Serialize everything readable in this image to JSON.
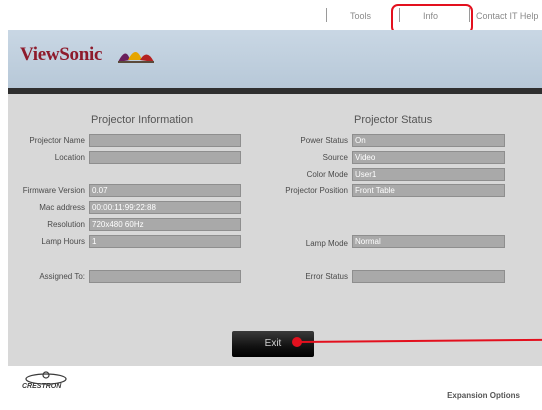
{
  "nav": {
    "tools": "Tools",
    "info": "Info",
    "contact": "Contact IT Help"
  },
  "brand": {
    "name": "ViewSonic",
    "logo_icon": "viewsonic-birds-icon"
  },
  "projector_information": {
    "title": "Projector Information",
    "fields": {
      "projector_name": {
        "label": "Projector Name",
        "value": ""
      },
      "location": {
        "label": "Location",
        "value": ""
      },
      "firmware_version": {
        "label": "Firmware Version",
        "value": "0.07"
      },
      "mac_address": {
        "label": "Mac address",
        "value": "00:00:11:99:22:88"
      },
      "resolution": {
        "label": "Resolution",
        "value": "720x480 60Hz"
      },
      "lamp_hours": {
        "label": "Lamp Hours",
        "value": "1"
      },
      "assigned_to": {
        "label": "Assigned To:",
        "value": ""
      }
    }
  },
  "projector_status": {
    "title": "Projector Status",
    "fields": {
      "power_status": {
        "label": "Power Status",
        "value": "On"
      },
      "source": {
        "label": "Source",
        "value": "Video"
      },
      "color_mode": {
        "label": "Color Mode",
        "value": "User1"
      },
      "projector_position": {
        "label": "Projector Position",
        "value": "Front Table"
      },
      "lamp_mode": {
        "label": "Lamp Mode",
        "value": "Normal"
      },
      "error_status": {
        "label": "Error Status",
        "value": ""
      }
    }
  },
  "exit_label": "Exit",
  "footer": {
    "crestron": "CRESTRON",
    "expansion": "Expansion Options"
  },
  "colors": {
    "highlight": "#e3101e",
    "brand": "#8e1b2c"
  }
}
